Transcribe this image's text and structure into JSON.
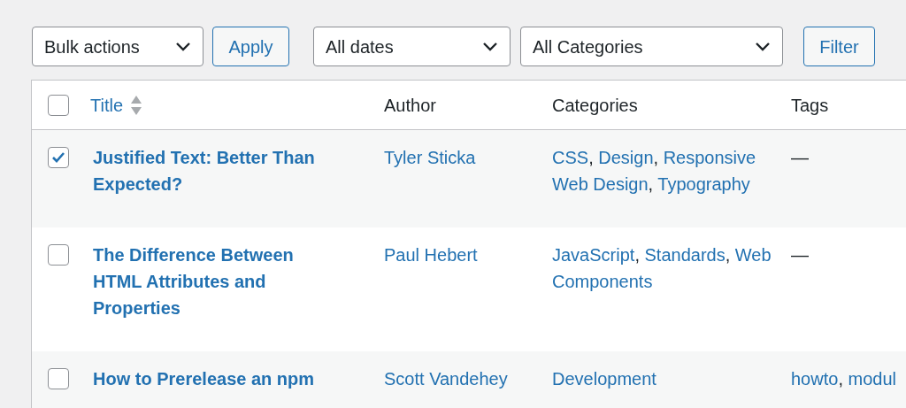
{
  "toolbar": {
    "bulk_actions": "Bulk actions",
    "apply": "Apply",
    "dates": "All dates",
    "categories": "All Categories",
    "filter": "Filter"
  },
  "table": {
    "columns": {
      "title": "Title",
      "author": "Author",
      "categories": "Categories",
      "tags": "Tags"
    },
    "select_all": {
      "checked": false
    },
    "separator": ",",
    "rows": [
      {
        "title": "Justified Text: Better Than Expected?",
        "author": "Tyler Sticka",
        "categories": [
          "CSS",
          "Design",
          "Responsive Web Design",
          "Typography"
        ],
        "tags": [],
        "no_tags": "—",
        "selected": true
      },
      {
        "title": "The Difference Between HTML Attributes and Properties",
        "author": "Paul Hebert",
        "categories": [
          "JavaScript",
          "Standards",
          "Web Components"
        ],
        "tags": [],
        "no_tags": "—",
        "selected": false
      },
      {
        "title": "How to Prerelease an npm",
        "author": "Scott Vandehey",
        "categories": [
          "Development"
        ],
        "tags": [
          "howto",
          "modul"
        ],
        "selected": false
      }
    ]
  }
}
